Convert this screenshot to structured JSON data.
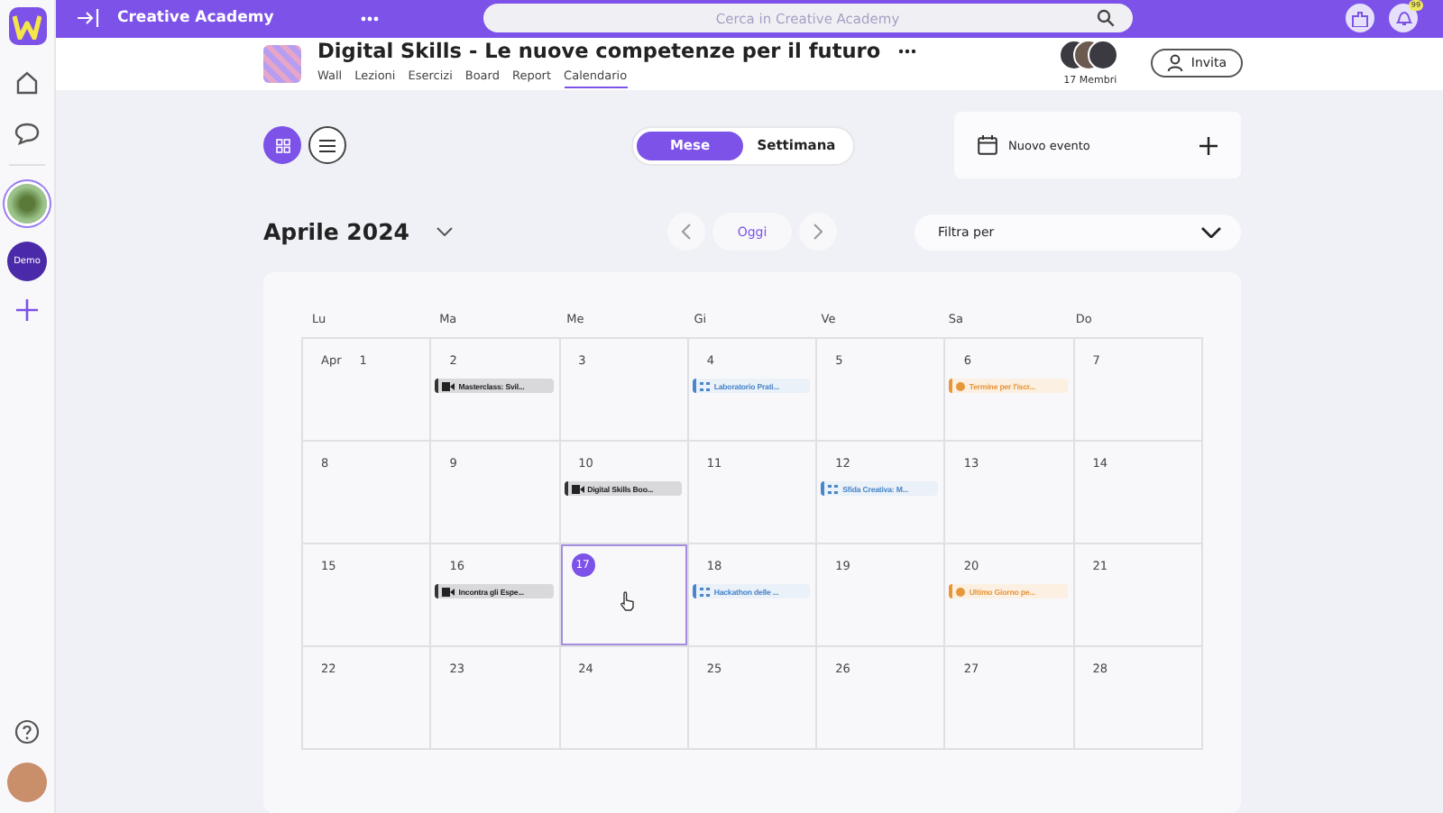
{
  "topbar": {
    "title": "Creative Academy",
    "search": {
      "placeholder": "Cerca in Creative Academy"
    },
    "notification_badge": "99"
  },
  "rail": {
    "spaces": [
      {
        "kind": "image",
        "selected": true
      },
      {
        "kind": "text",
        "label": "Demo",
        "selected": false
      }
    ]
  },
  "course": {
    "title": "Digital Skills - Le nuove competenze per il futuro",
    "members": "17 Membri",
    "invite": "Invita",
    "tabs": [
      {
        "label": "Wall",
        "selected": false
      },
      {
        "label": "Lezioni",
        "selected": false
      },
      {
        "label": "Esercizi",
        "selected": false
      },
      {
        "label": "Board",
        "selected": false
      },
      {
        "label": "Report",
        "selected": false
      },
      {
        "label": "Calendario",
        "selected": true
      }
    ]
  },
  "view_toggle": [
    {
      "kind": "grid",
      "selected": true
    },
    {
      "kind": "list",
      "selected": false
    }
  ],
  "range": [
    {
      "label": "Mese",
      "selected": true
    },
    {
      "label": "Settimana",
      "selected": false
    }
  ],
  "new_event": "Nuovo evento",
  "month": "Aprile 2024",
  "today_button": "Oggi",
  "filter": "Filtra per",
  "weekdays": [
    "Lu",
    "Ma",
    "Me",
    "Gi",
    "Ve",
    "Sa",
    "Do"
  ],
  "weeks": [
    [
      {
        "day": "1",
        "month_label": "Apr",
        "today": false
      },
      {
        "day": "2",
        "today": false,
        "events": [
          {
            "kind": "video",
            "title": "Masterclass: Svil...",
            "color": "#333333"
          }
        ]
      },
      {
        "day": "3",
        "today": false
      },
      {
        "day": "4",
        "today": false,
        "events": [
          {
            "kind": "workshop",
            "title": "Laboratorio Prati...",
            "color": "#4a86c8"
          }
        ]
      },
      {
        "day": "5",
        "today": false
      },
      {
        "day": "6",
        "today": false,
        "events": [
          {
            "kind": "deadline",
            "title": "Termine per l'iscr...",
            "color": "#e8963a"
          }
        ]
      },
      {
        "day": "7",
        "today": false
      }
    ],
    [
      {
        "day": "8",
        "today": false
      },
      {
        "day": "9",
        "today": false
      },
      {
        "day": "10",
        "today": false,
        "events": [
          {
            "kind": "video",
            "title": "Digital Skills Boo...",
            "color": "#333333"
          }
        ]
      },
      {
        "day": "11",
        "today": false
      },
      {
        "day": "12",
        "today": false,
        "events": [
          {
            "kind": "workshop",
            "title": "Sfida Creativa: M...",
            "color": "#4a86c8"
          }
        ]
      },
      {
        "day": "13",
        "today": false
      },
      {
        "day": "14",
        "today": false
      }
    ],
    [
      {
        "day": "15",
        "today": false
      },
      {
        "day": "16",
        "today": false,
        "events": [
          {
            "kind": "video",
            "title": "Incontra gli Espe...",
            "color": "#333333"
          }
        ]
      },
      {
        "day": "17",
        "today": true
      },
      {
        "day": "18",
        "today": false,
        "events": [
          {
            "kind": "workshop",
            "title": "Hackathon delle ...",
            "color": "#4a86c8"
          }
        ]
      },
      {
        "day": "19",
        "today": false
      },
      {
        "day": "20",
        "today": false,
        "events": [
          {
            "kind": "deadline",
            "title": "Ultimo Giorno pe...",
            "color": "#e8963a"
          }
        ]
      },
      {
        "day": "21",
        "today": false
      }
    ],
    [
      {
        "day": "22",
        "today": false
      },
      {
        "day": "23",
        "today": false
      },
      {
        "day": "24",
        "today": false
      },
      {
        "day": "25",
        "today": false
      },
      {
        "day": "26",
        "today": false
      },
      {
        "day": "27",
        "today": false
      },
      {
        "day": "28",
        "today": false
      }
    ]
  ]
}
